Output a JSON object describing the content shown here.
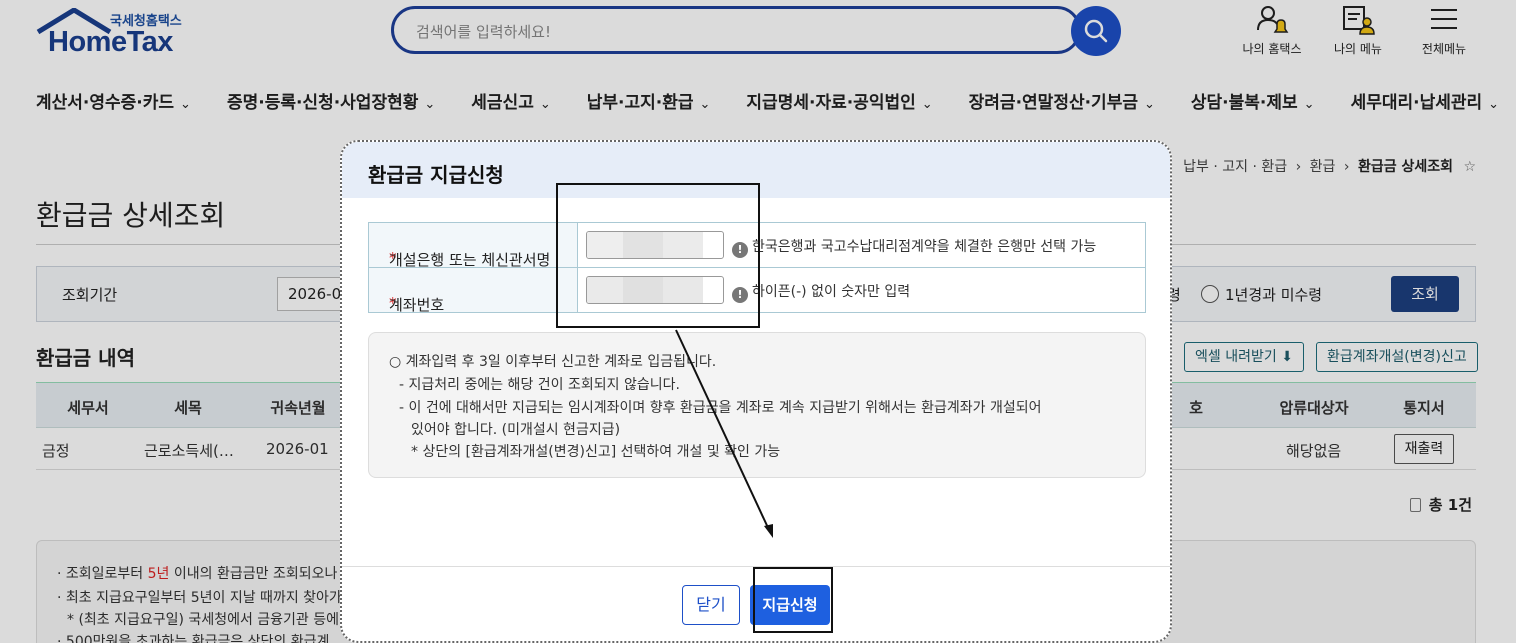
{
  "header": {
    "logo_sub": "국세청홈택스",
    "logo_main": "HomeTax",
    "search_placeholder": "검색어를 입력하세요!",
    "icons": [
      {
        "label": "나의 홈택스",
        "icon": "user-bell-icon"
      },
      {
        "label": "나의 메뉴",
        "icon": "my-menu-icon"
      },
      {
        "label": "전체메뉴",
        "icon": "hamburger-icon"
      }
    ],
    "nav": [
      "계산서·영수증·카드",
      "증명·등록·신청·사업장현황",
      "세금신고",
      "납부·고지·환급",
      "지급명세·자료·공익법인",
      "장려금·연말정산·기부금",
      "상담·불복·제보",
      "세무대리·납세관리"
    ]
  },
  "breadcrumb": {
    "items": [
      "납부 · 고지 · 환급",
      "환급"
    ],
    "current": "환급금 상세조회",
    "separator": "›"
  },
  "page": {
    "title": "환급금 상세조회",
    "filter": {
      "label": "조회기간",
      "select_value": "2026-0",
      "radio_partial": "령",
      "radio_option": "1년경과 미수령",
      "button": "조회"
    },
    "section_title": "환급금 내역",
    "excel_button": "엑셀 내려받기",
    "account_button": "환급계좌개설(변경)신고",
    "table": {
      "headers": [
        "세무서",
        "세목",
        "귀속년월",
        "호",
        "압류대상자",
        "통지서"
      ],
      "row": {
        "office": "금정",
        "tax_item": "근로소득세(…",
        "period": "2026-01",
        "seizure": "해당없음",
        "reprint": "재출력"
      }
    },
    "total": "총 1건",
    "notices": {
      "line1_prefix": "조회일로부터 ",
      "line1_red": "5년",
      "line1_suffix": " 이내의 환급금만 조회되오나",
      "line2": "최초 지급요구일부터 5년이 지날 때까지 찾아가",
      "line3": "* (최초 지급요구일) 국세청에서 금융기관 등에",
      "line4": "500만원을 초과하는 환급금은 상단의 환급계"
    }
  },
  "modal": {
    "title": "환급금 지급신청",
    "fields": [
      {
        "label": "개설은행 또는 체신관서명",
        "required": "*",
        "hint": "한국은행과 국고수납대리점계약을 체결한 은행만 선택 가능"
      },
      {
        "label": "계좌번호",
        "required": "*",
        "hint": "하이픈(-) 없이 숫자만 입력"
      }
    ],
    "info": [
      "○ 계좌입력 후 3일 이후부터 신고한 계좌로 입금됩니다.",
      "- 지급처리 중에는 해당 건이 조회되지 않습니다.",
      "- 이 건에 대해서만 지급되는 임시계좌이며 향후 환급금을 계좌로 계속 지급받기 위해서는 환급계좌가 개설되어",
      "있어야 합니다. (미개설시 현금지급)",
      "* 상단의 [환급계좌개설(변경)신고] 선택하여 개설 및 확인 가능"
    ],
    "close_button": "닫기",
    "apply_button": "지급신청"
  },
  "colors": {
    "brand": "#1a3f8f",
    "accent": "#1e60e0",
    "required": "#dd2222"
  }
}
